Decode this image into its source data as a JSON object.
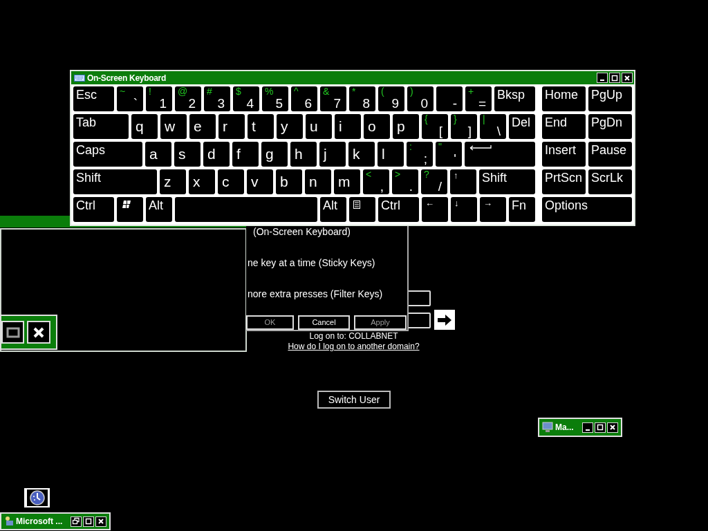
{
  "keyboard_window": {
    "title": "On-Screen Keyboard",
    "rows": [
      {
        "keys": [
          {
            "kind": "name",
            "label": "Esc"
          },
          {
            "kind": "char",
            "shift": "~",
            "label": "`"
          },
          {
            "kind": "char",
            "shift": "!",
            "label": "1"
          },
          {
            "kind": "char",
            "shift": "@",
            "label": "2"
          },
          {
            "kind": "char",
            "shift": "#",
            "label": "3"
          },
          {
            "kind": "char",
            "shift": "$",
            "label": "4"
          },
          {
            "kind": "char",
            "shift": "%",
            "label": "5"
          },
          {
            "kind": "char",
            "shift": "^",
            "label": "6"
          },
          {
            "kind": "char",
            "shift": "&",
            "label": "7"
          },
          {
            "kind": "char",
            "shift": "*",
            "label": "8"
          },
          {
            "kind": "char",
            "shift": "(",
            "label": "9"
          },
          {
            "kind": "char",
            "shift": ")",
            "label": "0"
          },
          {
            "kind": "char",
            "label": "-"
          },
          {
            "kind": "char",
            "shift": "+",
            "label": "="
          },
          {
            "kind": "name",
            "label": "Bksp"
          }
        ]
      },
      {
        "keys": [
          {
            "kind": "name",
            "label": "Tab"
          },
          {
            "kind": "letter",
            "label": "q"
          },
          {
            "kind": "letter",
            "label": "w"
          },
          {
            "kind": "letter",
            "label": "e"
          },
          {
            "kind": "letter",
            "label": "r"
          },
          {
            "kind": "letter",
            "label": "t"
          },
          {
            "kind": "letter",
            "label": "y"
          },
          {
            "kind": "letter",
            "label": "u"
          },
          {
            "kind": "letter",
            "label": "i"
          },
          {
            "kind": "letter",
            "label": "o"
          },
          {
            "kind": "letter",
            "label": "p"
          },
          {
            "kind": "char",
            "shift": "{",
            "label": "["
          },
          {
            "kind": "char",
            "shift": "}",
            "label": "]"
          },
          {
            "kind": "char",
            "shift": "|",
            "label": "\\"
          },
          {
            "kind": "name",
            "label": "Del"
          }
        ]
      },
      {
        "keys": [
          {
            "kind": "name",
            "label": "Caps"
          },
          {
            "kind": "letter",
            "label": "a"
          },
          {
            "kind": "letter",
            "label": "s"
          },
          {
            "kind": "letter",
            "label": "d"
          },
          {
            "kind": "letter",
            "label": "f"
          },
          {
            "kind": "letter",
            "label": "g"
          },
          {
            "kind": "letter",
            "label": "h"
          },
          {
            "kind": "letter",
            "label": "j"
          },
          {
            "kind": "letter",
            "label": "k"
          },
          {
            "kind": "letter",
            "label": "l"
          },
          {
            "kind": "char",
            "shift": ":",
            "label": ";"
          },
          {
            "kind": "char",
            "shift": "\"",
            "label": "'"
          },
          {
            "kind": "enter"
          }
        ]
      },
      {
        "keys": [
          {
            "kind": "name",
            "label": "Shift"
          },
          {
            "kind": "letter",
            "label": "z"
          },
          {
            "kind": "letter",
            "label": "x"
          },
          {
            "kind": "letter",
            "label": "c"
          },
          {
            "kind": "letter",
            "label": "v"
          },
          {
            "kind": "letter",
            "label": "b"
          },
          {
            "kind": "letter",
            "label": "n"
          },
          {
            "kind": "letter",
            "label": "m"
          },
          {
            "kind": "char",
            "shift": "<",
            "label": ","
          },
          {
            "kind": "char",
            "shift": ">",
            "label": "."
          },
          {
            "kind": "char",
            "shift": "?",
            "label": "/"
          },
          {
            "kind": "arrow",
            "label": "↑"
          },
          {
            "kind": "name",
            "label": "Shift"
          }
        ]
      },
      {
        "keys": [
          {
            "kind": "name",
            "label": "Ctrl"
          },
          {
            "kind": "windows"
          },
          {
            "kind": "name",
            "label": "Alt"
          },
          {
            "kind": "space"
          },
          {
            "kind": "name",
            "label": "Alt"
          },
          {
            "kind": "menu"
          },
          {
            "kind": "name",
            "label": "Ctrl"
          },
          {
            "kind": "arrow",
            "label": "←"
          },
          {
            "kind": "arrow",
            "label": "↓"
          },
          {
            "kind": "arrow",
            "label": "→"
          },
          {
            "kind": "name",
            "label": "Fn"
          }
        ]
      }
    ],
    "nav_rows": [
      {
        "keys": [
          {
            "kind": "name",
            "label": "Home"
          },
          {
            "kind": "name",
            "label": "PgUp"
          }
        ]
      },
      {
        "keys": [
          {
            "kind": "name",
            "label": "End"
          },
          {
            "kind": "name",
            "label": "PgDn"
          }
        ]
      },
      {
        "keys": [
          {
            "kind": "name",
            "label": "Insert"
          },
          {
            "kind": "name",
            "label": "Pause"
          }
        ]
      },
      {
        "keys": [
          {
            "kind": "name",
            "label": "PrtScn"
          },
          {
            "kind": "name",
            "label": "ScrLk"
          }
        ]
      },
      {
        "keys": [
          {
            "kind": "name",
            "label": "Options"
          }
        ]
      }
    ]
  },
  "dialog": {
    "lines": [
      "(On-Screen Keyboard)",
      "ne key at a time (Sticky Keys)",
      "nore extra presses (Filter Keys)"
    ],
    "buttons": [
      {
        "label": "OK",
        "disabled": true
      },
      {
        "label": "Cancel",
        "disabled": false
      },
      {
        "label": "Apply",
        "disabled": true
      }
    ]
  },
  "logon": {
    "domain": "Log on to: COLLABNET",
    "link": "How do I log on to another domain?"
  },
  "switch_user": "Switch User",
  "mini_window": {
    "title": "Ma..."
  },
  "taskbar_window": {
    "title": "Microsoft ..."
  }
}
